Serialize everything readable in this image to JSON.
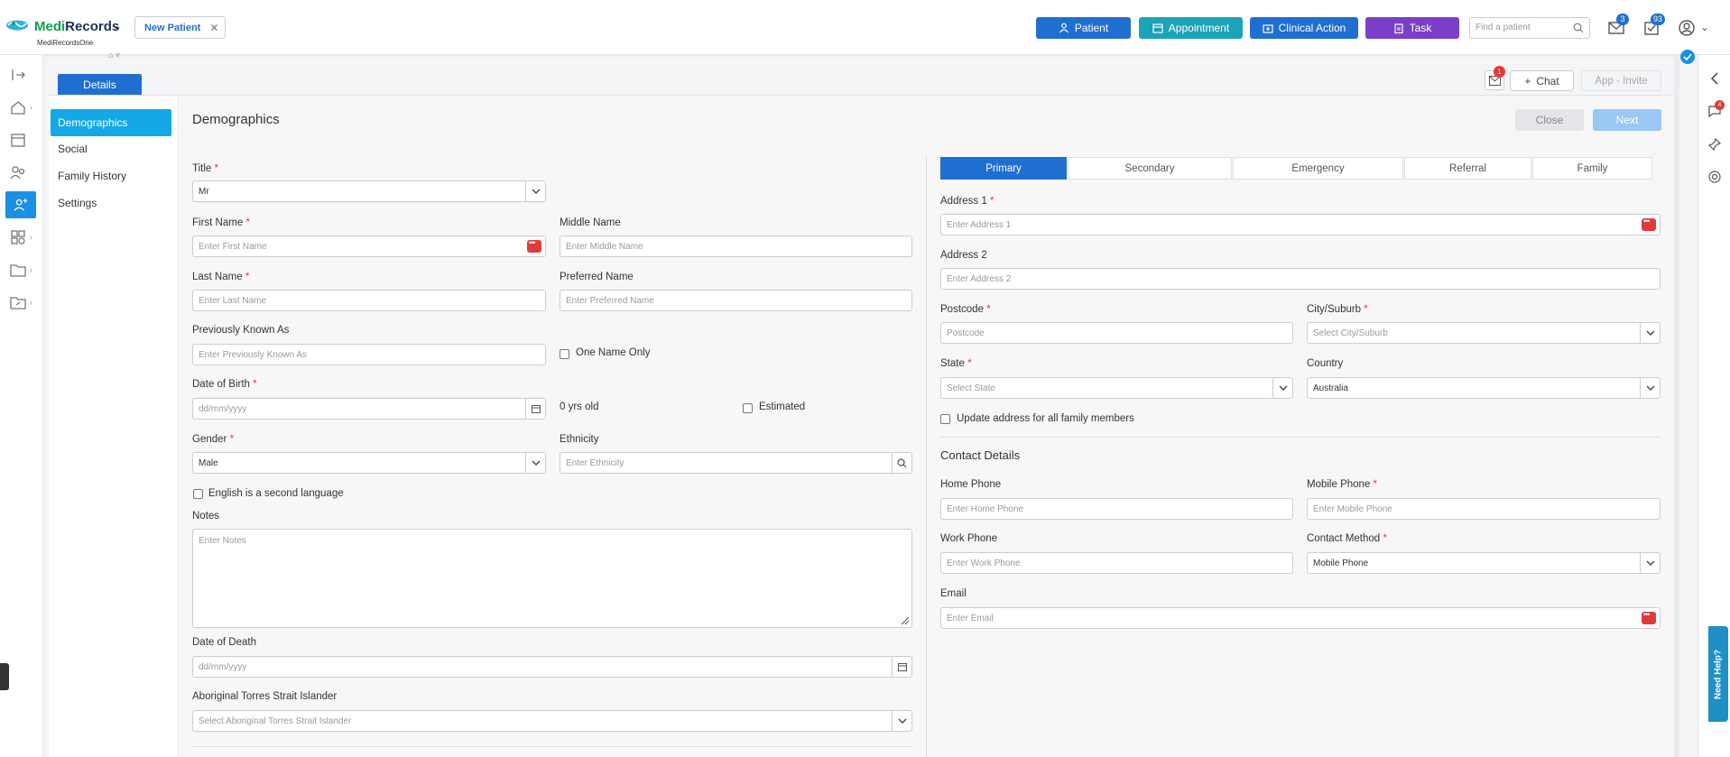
{
  "app": {
    "brand_medi": "Medi",
    "brand_records": "Records",
    "brand_sub": "MediRecordsOne",
    "open_tab": "New Patient"
  },
  "header": {
    "patient_btn": "Patient",
    "appointment_btn": "Appointment",
    "clinical_btn": "Clinical Action",
    "task_btn": "Task",
    "search_placeholder": "Find a patient",
    "mail_badge": "3",
    "tasks_badge": "93"
  },
  "toolbar": {
    "details_tab": "Details",
    "notif_badge": "1",
    "chat_btn": "Chat",
    "app_invite_btn": "App - Invite"
  },
  "subnav": [
    "Demographics",
    "Social",
    "Family History",
    "Settings"
  ],
  "page": {
    "title": "Demographics",
    "close_btn": "Close",
    "next_btn": "Next"
  },
  "left": {
    "title_label": "Title",
    "title_value": "Mr",
    "first_name_label": "First Name",
    "first_name_ph": "Enter First Name",
    "middle_name_label": "Middle Name",
    "middle_name_ph": "Enter Middle Name",
    "last_name_label": "Last Name",
    "last_name_ph": "Enter Last Name",
    "preferred_name_label": "Preferred Name",
    "preferred_name_ph": "Enter Preferred Name",
    "prev_known_label": "Previously Known As",
    "prev_known_ph": "Enter Previously Known As",
    "one_name_only": "One Name Only",
    "dob_label": "Date of Birth",
    "dob_ph": "dd/mm/yyyy",
    "age_text": "0 yrs old",
    "estimated": "Estimated",
    "gender_label": "Gender",
    "gender_value": "Male",
    "ethnicity_label": "Ethnicity",
    "ethnicity_ph": "Enter Ethnicity",
    "english_second": "English is a second language",
    "notes_label": "Notes",
    "notes_ph": "Enter Notes",
    "dod_label": "Date of Death",
    "dod_ph": "dd/mm/yyyy",
    "atsi_label": "Aboriginal Torres Strait Islander",
    "atsi_ph": "Select Aboriginal Torres Strait Islander"
  },
  "right": {
    "tabs": [
      "Primary",
      "Secondary",
      "Emergency",
      "Referral",
      "Family"
    ],
    "address1_label": "Address 1",
    "address1_ph": "Enter Address 1",
    "address2_label": "Address 2",
    "address2_ph": "Enter Address 2",
    "postcode_label": "Postcode",
    "postcode_ph": "Postcode",
    "city_label": "City/Suburb",
    "city_ph": "Select City/Suburb",
    "state_label": "State",
    "state_ph": "Select State",
    "country_label": "Country",
    "country_value": "Australia",
    "update_family": "Update address for all family members",
    "contact_heading": "Contact Details",
    "home_phone_label": "Home Phone",
    "home_phone_ph": "Enter Home Phone",
    "mobile_phone_label": "Mobile Phone",
    "mobile_phone_ph": "Enter Mobile Phone",
    "work_phone_label": "Work Phone",
    "work_phone_ph": "Enter Work Phone",
    "contact_method_label": "Contact Method",
    "contact_method_value": "Mobile Phone",
    "email_label": "Email",
    "email_ph": "Enter Email"
  },
  "right_panel": {
    "need_help": "Need Help?",
    "notif_badge": "4"
  },
  "colors": {
    "primary": "#1f6fd1",
    "appointment": "#1ba3b8",
    "task": "#7b3ec9",
    "active_subnav": "#15a8e8",
    "required": "#e53935"
  }
}
